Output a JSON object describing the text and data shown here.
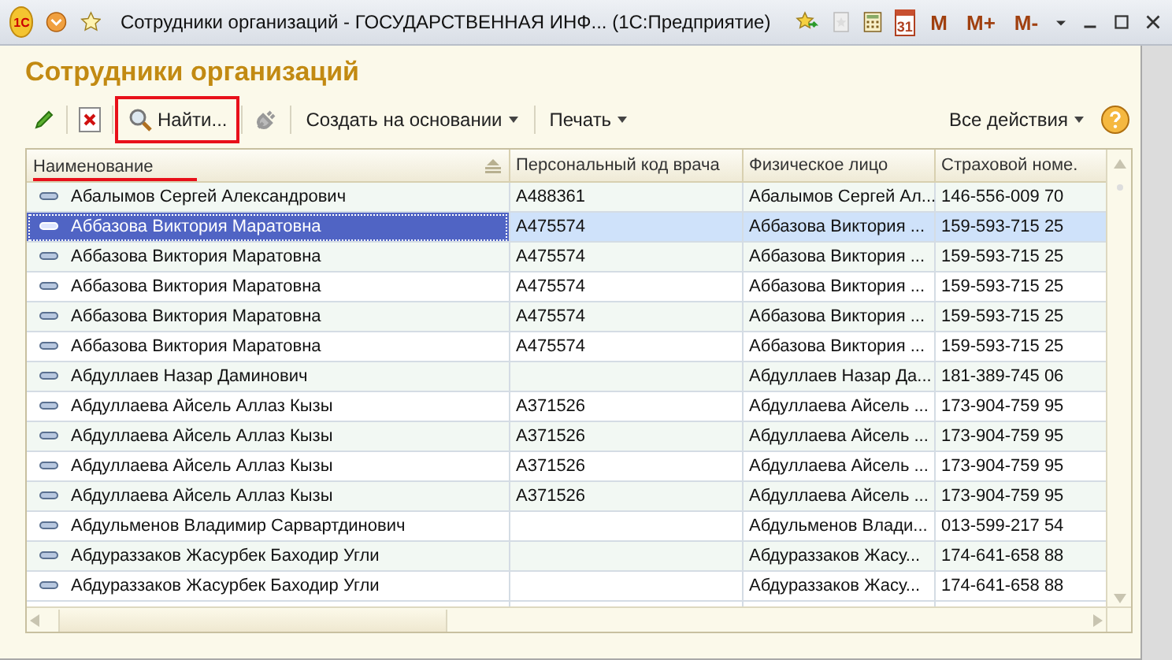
{
  "window": {
    "app_logo": "1С",
    "title": "Сотрудники организаций - ГОСУДАРСТВЕННАЯ ИНФ...  (1С:Предприятие)",
    "calendar_day": "31",
    "memory_buttons": [
      "M",
      "M+",
      "M-"
    ]
  },
  "form": {
    "title": "Сотрудники организаций"
  },
  "toolbar": {
    "find": {
      "label": "Найти...",
      "highlighted": true
    },
    "create_based_on": "Создать на основании",
    "print": "Печать",
    "all_actions": "Все действия"
  },
  "table": {
    "columns": [
      {
        "label": "Наименование",
        "sorted": true,
        "highlighted": true
      },
      {
        "label": "Персональный код врача",
        "sorted": false,
        "highlighted": false
      },
      {
        "label": "Физическое лицо",
        "sorted": false,
        "highlighted": false
      },
      {
        "label": "Страховой номе.",
        "sorted": false,
        "highlighted": false
      }
    ],
    "rows": [
      {
        "name": "Абалымов Сергей Александрович",
        "doctor_code": "А488361",
        "person": "Абалымов Сергей Ал...",
        "insurance_number": "146-556-009 70",
        "selected": false
      },
      {
        "name": "Аббазова Виктория Маратовна",
        "doctor_code": "А475574",
        "person": "Аббазова Виктория ...",
        "insurance_number": "159-593-715 25",
        "selected": true
      },
      {
        "name": "Аббазова Виктория Маратовна",
        "doctor_code": "А475574",
        "person": "Аббазова Виктория ...",
        "insurance_number": "159-593-715 25",
        "selected": false
      },
      {
        "name": "Аббазова Виктория Маратовна",
        "doctor_code": "А475574",
        "person": "Аббазова Виктория ...",
        "insurance_number": "159-593-715 25",
        "selected": false
      },
      {
        "name": "Аббазова Виктория Маратовна",
        "doctor_code": "А475574",
        "person": "Аббазова Виктория ...",
        "insurance_number": "159-593-715 25",
        "selected": false
      },
      {
        "name": "Аббазова Виктория Маратовна",
        "doctor_code": "А475574",
        "person": "Аббазова Виктория ...",
        "insurance_number": "159-593-715 25",
        "selected": false
      },
      {
        "name": "Абдуллаев Назар Даминович",
        "doctor_code": "",
        "person": "Абдуллаев Назар Да...",
        "insurance_number": "181-389-745 06",
        "selected": false
      },
      {
        "name": "Абдуллаева Айсель Аллаз Кызы",
        "doctor_code": "А371526",
        "person": "Абдуллаева Айсель ...",
        "insurance_number": "173-904-759 95",
        "selected": false
      },
      {
        "name": "Абдуллаева Айсель Аллаз Кызы",
        "doctor_code": "А371526",
        "person": "Абдуллаева Айсель ...",
        "insurance_number": "173-904-759 95",
        "selected": false
      },
      {
        "name": "Абдуллаева Айсель Аллаз Кызы",
        "doctor_code": "А371526",
        "person": "Абдуллаева Айсель ...",
        "insurance_number": "173-904-759 95",
        "selected": false
      },
      {
        "name": "Абдуллаева Айсель Аллаз Кызы",
        "doctor_code": "А371526",
        "person": "Абдуллаева Айсель ...",
        "insurance_number": "173-904-759 95",
        "selected": false
      },
      {
        "name": "Абдульменов Владимир Сарвартдинович",
        "doctor_code": "",
        "person": "Абдульменов Влади...",
        "insurance_number": "013-599-217 54",
        "selected": false
      },
      {
        "name": "Абдураззаков Жасурбек Баходир Угли",
        "doctor_code": "",
        "person": "Абдураззаков Жасу...",
        "insurance_number": "174-641-658 88",
        "selected": false
      },
      {
        "name": "Абдураззаков Жасурбек Баходир Угли",
        "doctor_code": "",
        "person": "Абдураззаков Жасу...",
        "insurance_number": "174-641-658 88",
        "selected": false
      }
    ]
  }
}
